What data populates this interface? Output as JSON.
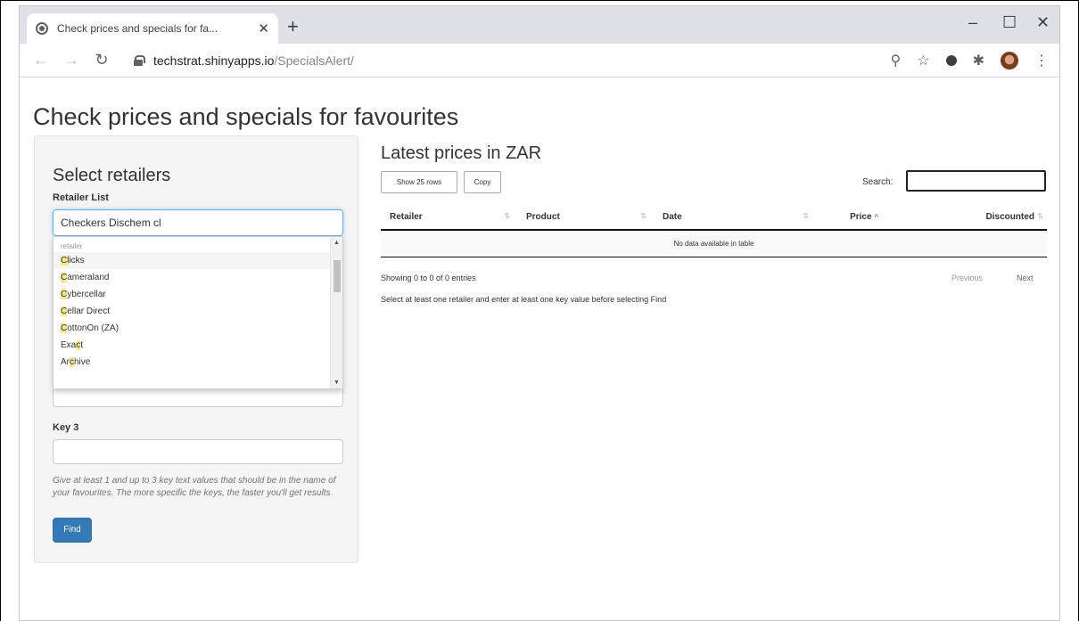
{
  "browser": {
    "tab_title": "Check prices and specials for fa...",
    "url_host": "techstrat.shinyapps.io",
    "url_path": "/SpecialsAlert/",
    "minimize": "–",
    "maximize": "☐",
    "close": "✕",
    "new_tab": "+",
    "tab_close": "✕"
  },
  "page": {
    "title": "Check prices and specials for favourites"
  },
  "sidebar": {
    "heading": "Select retailers",
    "retailer_label": "Retailer List",
    "retailer_value": "Checkers  Dischem  cl",
    "dropdown_header": "retailer",
    "options": [
      {
        "pre": "",
        "hl": "Cl",
        "post": "icks"
      },
      {
        "pre": "",
        "hl": "C",
        "post": "ameraland"
      },
      {
        "pre": "",
        "hl": "C",
        "post": "ybercellar"
      },
      {
        "pre": "",
        "hl": "C",
        "post": "ellar Direct"
      },
      {
        "pre": "",
        "hl": "C",
        "post": "ottonOn (ZA)"
      },
      {
        "pre": "Exa",
        "hl": "c",
        "post": "t"
      },
      {
        "pre": "Ar",
        "hl": "c",
        "post": "hive"
      }
    ],
    "key3_label": "Key 3",
    "help_text": "Give at least 1 and up to 3 key text values that should be in the name of your favourites. The more specific the keys, the faster you'll get results",
    "find_label": "Find"
  },
  "main": {
    "title": "Latest prices in ZAR",
    "show_rows_label": "Show 25 rows",
    "copy_label": "Copy",
    "search_label": "Search:",
    "columns": [
      "Retailer",
      "Product",
      "Date",
      "Price",
      "Discounted"
    ],
    "empty_message": "No data available in table",
    "info": "Showing 0 to 0 of 0 entries",
    "previous_label": "Previous",
    "next_label": "Next",
    "note": "Select at least one retailer and enter at least one key value before selecting Find"
  }
}
